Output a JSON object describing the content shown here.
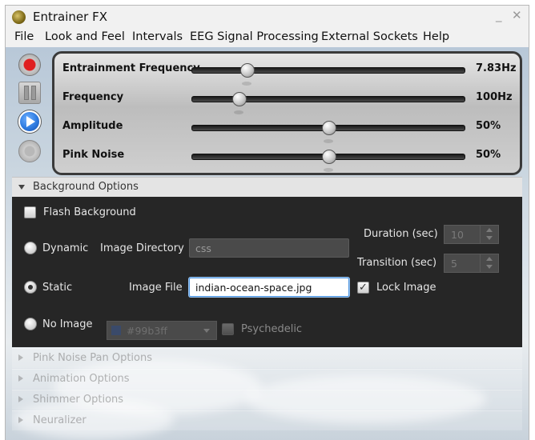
{
  "window": {
    "title": "Entrainer FX",
    "minimize_glyph": "_",
    "close_glyph": "✕"
  },
  "menu": [
    {
      "label": "File"
    },
    {
      "label": "Look and Feel"
    },
    {
      "label": "Intervals"
    },
    {
      "label": "EEG Signal Processing"
    },
    {
      "label": "External Sockets"
    },
    {
      "label": "Help"
    }
  ],
  "controls": {
    "record_icon": "record-icon",
    "pause_icon": "pause-icon",
    "play_icon": "play-icon",
    "stop_icon": "stop-icon"
  },
  "sliders": [
    {
      "label": "Entrainment Frequency",
      "value_text": "7.83Hz",
      "fraction": 0.2
    },
    {
      "label": "Frequency",
      "value_text": "100Hz",
      "fraction": 0.17
    },
    {
      "label": "Amplitude",
      "value_text": "50%",
      "fraction": 0.5
    },
    {
      "label": "Pink Noise",
      "value_text": "50%",
      "fraction": 0.5
    }
  ],
  "background_options": {
    "header": "Background Options",
    "flash_background": {
      "label": "Flash Background",
      "checked": false
    },
    "dynamic": {
      "label": "Dynamic",
      "selected": false
    },
    "image_directory": {
      "label": "Image Directory",
      "value": "css"
    },
    "duration": {
      "label": "Duration (sec)",
      "value": "10"
    },
    "transition": {
      "label": "Transition (sec)",
      "value": "5"
    },
    "static": {
      "label": "Static",
      "selected": true
    },
    "image_file": {
      "label": "Image File",
      "value": "indian-ocean-space.jpg"
    },
    "lock_image": {
      "label": "Lock Image",
      "checked": true,
      "check_glyph": "✓"
    },
    "no_image": {
      "label": "No Image",
      "selected": false
    },
    "color": {
      "value": "#99b3ff",
      "swatch": "#99b3ff"
    },
    "psychedelic": {
      "label": "Psychedelic",
      "checked": false
    }
  },
  "collapsed_sections": [
    {
      "label": "Pink Noise Pan Options"
    },
    {
      "label": "Animation Options"
    },
    {
      "label": "Shimmer Options"
    },
    {
      "label": "Neuralizer"
    }
  ],
  "colors": {
    "record": "#e02020",
    "play": "#2e7be0",
    "accent_focus": "#4e95e0"
  }
}
